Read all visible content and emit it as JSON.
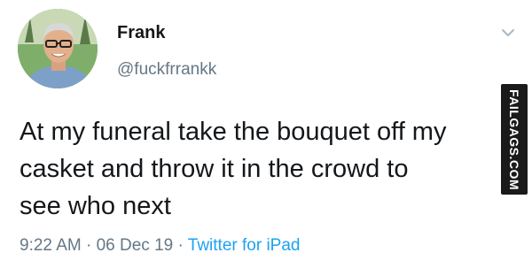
{
  "author": {
    "display_name": "Frank",
    "handle": "@fuckfrrankk"
  },
  "tweet": {
    "lines": [
      "At my funeral take the bouquet off my",
      "casket and throw it in the crowd to",
      "see who next"
    ]
  },
  "meta": {
    "time": "9:22 AM",
    "separator": "·",
    "date": "06 Dec 19",
    "source": "Twitter for iPad"
  },
  "watermark": {
    "text": "FAILGAGS.COM"
  },
  "icons": {
    "menu": "chevron-down-icon"
  },
  "colors": {
    "text": "#14171a",
    "secondary": "#657786",
    "link": "#1da1f2"
  }
}
